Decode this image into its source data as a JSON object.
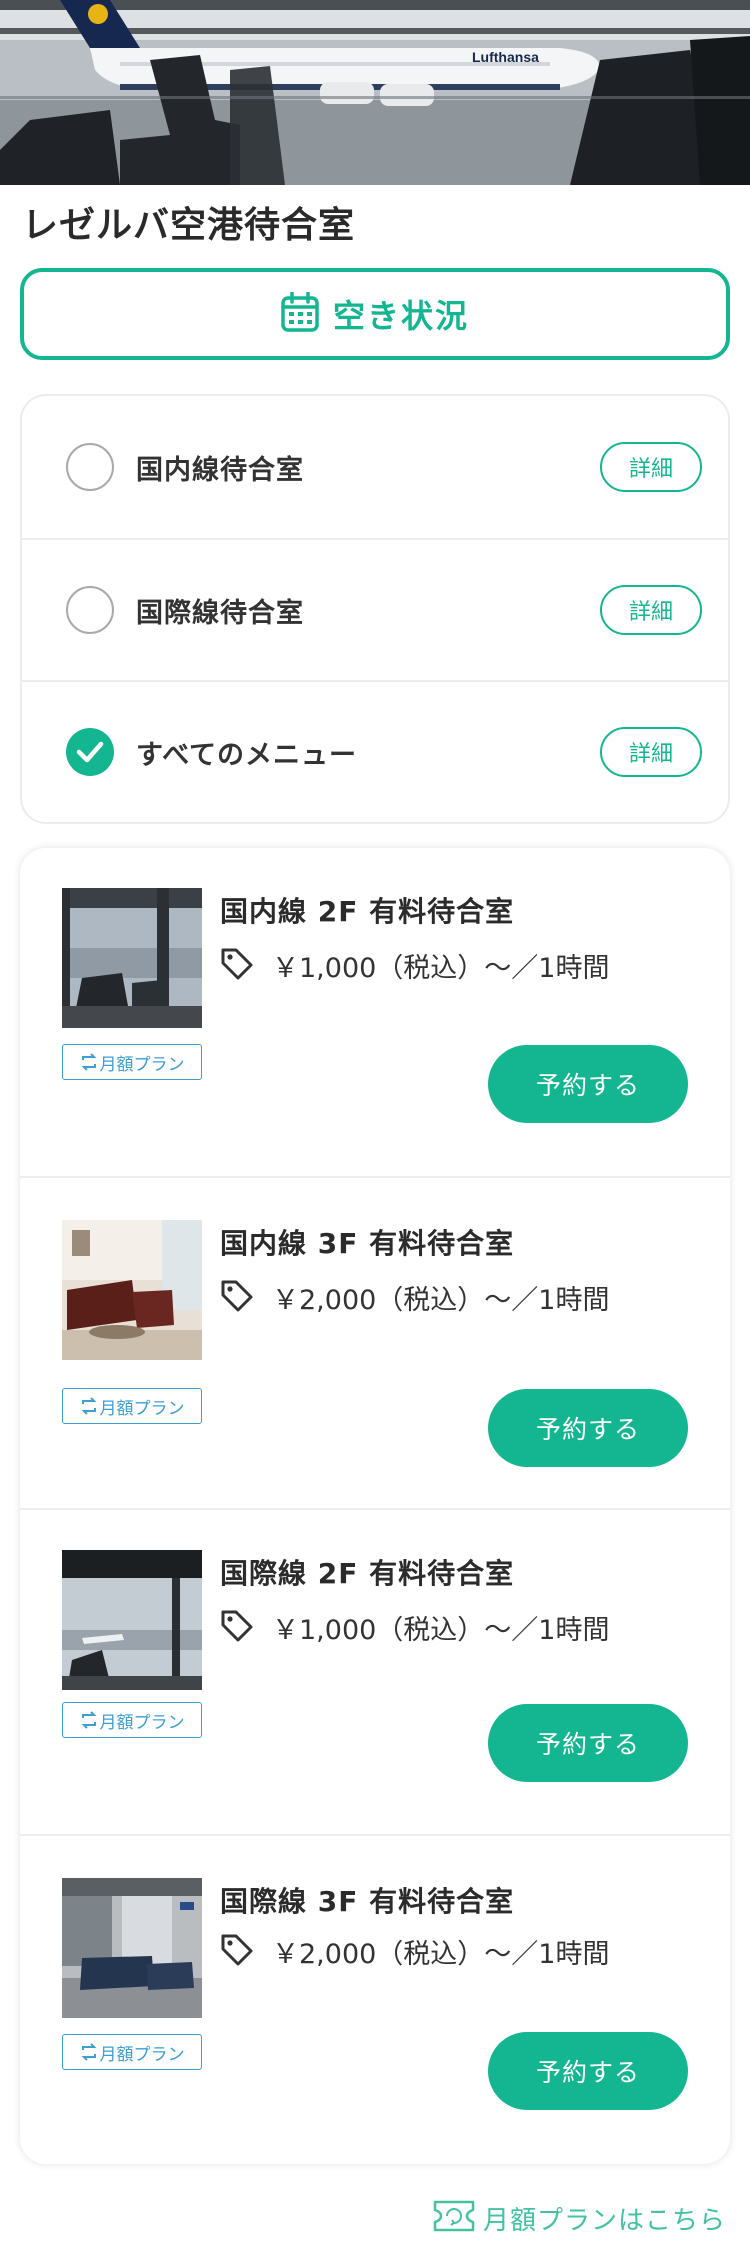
{
  "hero": {
    "icon": "airport-hero-photo",
    "brand": "Lufthansa"
  },
  "page": {
    "title": "レゼルバ空港待合室"
  },
  "availability_button": {
    "label": "空き状況",
    "icon": "calendar-icon"
  },
  "filters": [
    {
      "label": "国内線待合室",
      "checked": false,
      "detail": "詳細"
    },
    {
      "label": "国際線待合室",
      "checked": false,
      "detail": "詳細"
    },
    {
      "label": "すべてのメニュー",
      "checked": true,
      "detail": "詳細"
    }
  ],
  "lounges": [
    {
      "title": "国内線 2F 有料待合室",
      "price": "￥1,000（税込）〜／1時間",
      "plan_badge": "月額プラン",
      "reserve": "予約する"
    },
    {
      "title": "国内線 3F 有料待合室",
      "price": "￥2,000（税込）〜／1時間",
      "plan_badge": "月額プラン",
      "reserve": "予約する"
    },
    {
      "title": "国際線 2F 有料待合室",
      "price": "￥1,000（税込）〜／1時間",
      "plan_badge": "月額プラン",
      "reserve": "予約する"
    },
    {
      "title": "国際線 3F 有料待合室",
      "price": "￥2,000（税込）〜／1時間",
      "plan_badge": "月額プラン",
      "reserve": "予約する"
    }
  ],
  "footer": {
    "monthly_link": "月額プランはこちら",
    "icon": "ticket-icon"
  },
  "colors": {
    "accent": "#14b591",
    "badge": "#3d9ed2",
    "link": "#43c1a2"
  }
}
